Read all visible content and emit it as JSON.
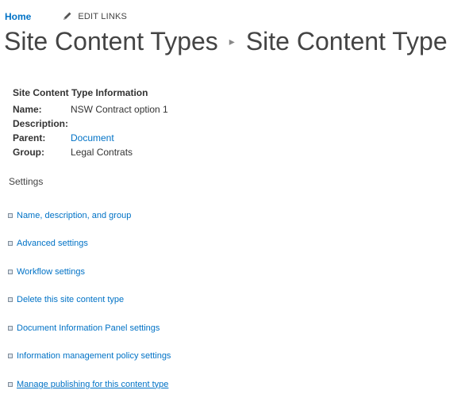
{
  "topnav": {
    "home_label": "Home",
    "edit_links_label": "EDIT LINKS"
  },
  "title": {
    "parent": "Site Content Types",
    "current": "Site Content Type"
  },
  "info": {
    "heading": "Site Content Type Information",
    "rows": [
      {
        "label": "Name:",
        "value": "NSW Contract option 1"
      },
      {
        "label": "Description:",
        "value": ""
      },
      {
        "label": "Parent:",
        "value": "Document"
      },
      {
        "label": "Group:",
        "value": "Legal Contrats"
      }
    ]
  },
  "settings": {
    "heading": "Settings",
    "items": [
      {
        "label": "Name, description, and group"
      },
      {
        "label": "Advanced settings"
      },
      {
        "label": "Workflow settings"
      },
      {
        "label": "Delete this site content type"
      },
      {
        "label": "Document Information Panel settings"
      },
      {
        "label": "Information management policy settings"
      },
      {
        "label": "Manage publishing for this content type"
      }
    ]
  },
  "colors": {
    "link": "#0072c6",
    "text": "#444444"
  }
}
